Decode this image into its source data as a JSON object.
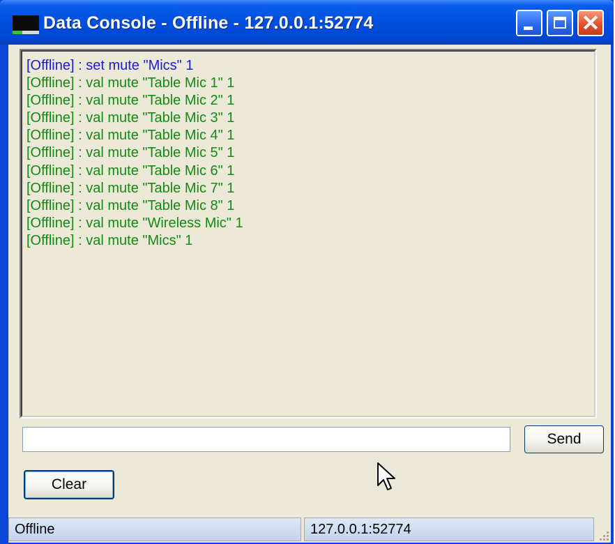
{
  "window": {
    "title": "Data Console - Offline - 127.0.0.1:52774",
    "controls": [
      "minimize-icon",
      "maximize-icon",
      "close-icon"
    ]
  },
  "console": {
    "lines": [
      {
        "text": "[Offline] : set mute \"Mics\" 1",
        "kind": "set",
        "color": "#1a1adc"
      },
      {
        "text": "[Offline] : val mute \"Table Mic 1\" 1",
        "kind": "val",
        "color": "#138a13"
      },
      {
        "text": "[Offline] : val mute \"Table Mic 2\" 1",
        "kind": "val",
        "color": "#138a13"
      },
      {
        "text": "[Offline] : val mute \"Table Mic 3\" 1",
        "kind": "val",
        "color": "#138a13"
      },
      {
        "text": "[Offline] : val mute \"Table Mic 4\" 1",
        "kind": "val",
        "color": "#138a13"
      },
      {
        "text": "[Offline] : val mute \"Table Mic 5\" 1",
        "kind": "val",
        "color": "#138a13"
      },
      {
        "text": "[Offline] : val mute \"Table Mic 6\" 1",
        "kind": "val",
        "color": "#138a13"
      },
      {
        "text": "[Offline] : val mute \"Table Mic 7\" 1",
        "kind": "val",
        "color": "#138a13"
      },
      {
        "text": "[Offline] : val mute \"Table Mic 8\" 1",
        "kind": "val",
        "color": "#138a13"
      },
      {
        "text": "[Offline] : val mute \"Wireless Mic\" 1",
        "kind": "val",
        "color": "#138a13"
      },
      {
        "text": "[Offline] : val mute \"Mics\" 1",
        "kind": "val",
        "color": "#138a13"
      }
    ]
  },
  "command": {
    "value": "",
    "send_label": "Send",
    "clear_label": "Clear"
  },
  "status": {
    "state": "Offline",
    "address": "127.0.0.1:52774"
  },
  "colors": {
    "title_bar": "#0050e0",
    "client_bg": "#ece9d8",
    "close_button": "#e2512c"
  }
}
